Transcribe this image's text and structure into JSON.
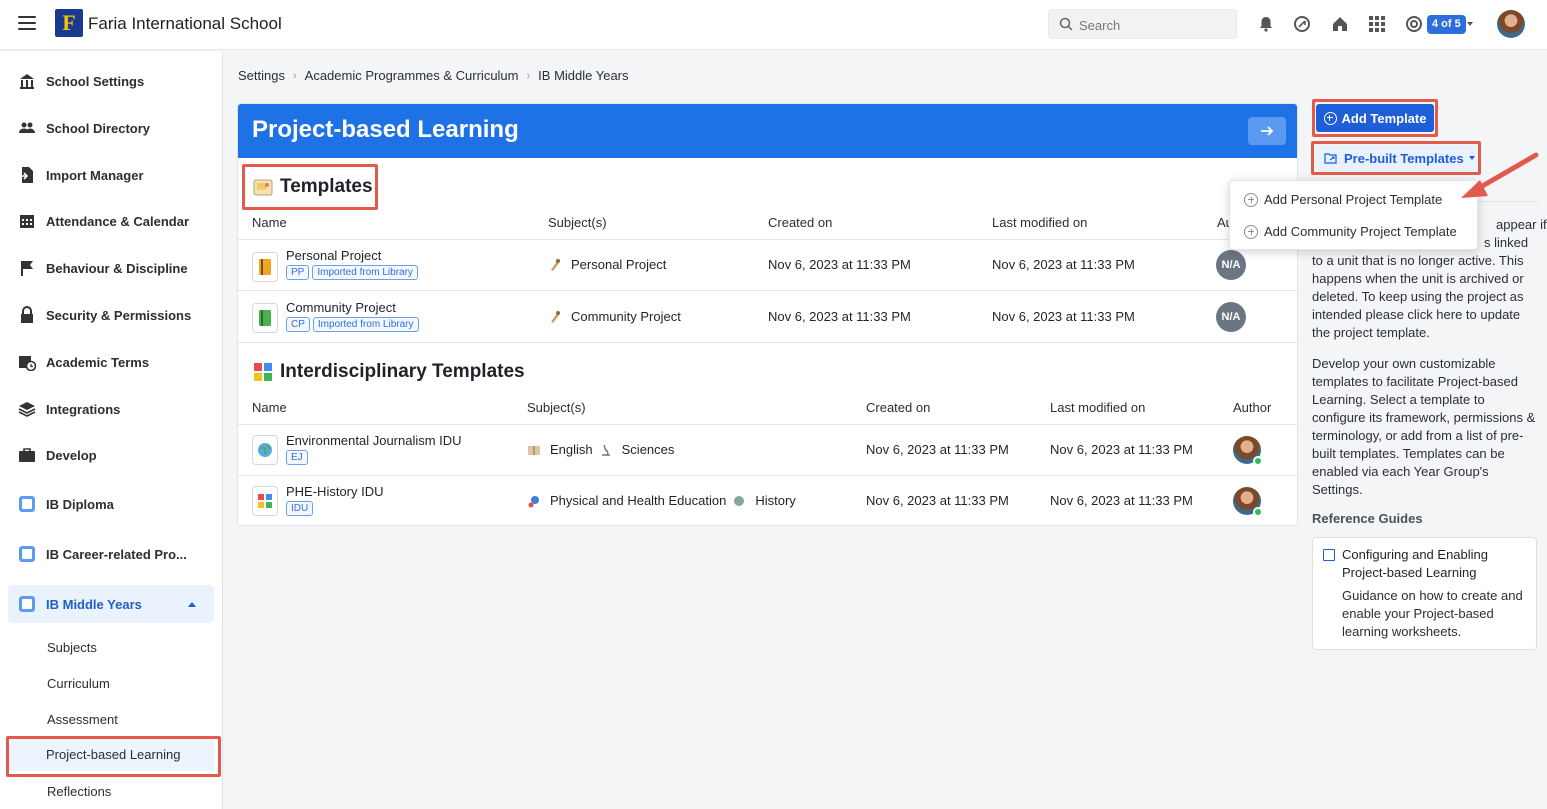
{
  "app": {
    "school_name": "Faria International School",
    "logo_letter": "F"
  },
  "topbar": {
    "search_placeholder": "Search",
    "switcher_badge": "4 of 5"
  },
  "sidebar": {
    "items": [
      {
        "label": "School Settings",
        "icon": "building-icon"
      },
      {
        "label": "School Directory",
        "icon": "people-icon"
      },
      {
        "label": "Import Manager",
        "icon": "import-icon"
      },
      {
        "label": "Attendance & Calendar",
        "icon": "calendar-icon"
      },
      {
        "label": "Behaviour & Discipline",
        "icon": "flag-icon"
      },
      {
        "label": "Security & Permissions",
        "icon": "lock-icon"
      },
      {
        "label": "Academic Terms",
        "icon": "calendar-clock-icon"
      },
      {
        "label": "Integrations",
        "icon": "layers-icon"
      },
      {
        "label": "Develop",
        "icon": "briefcase-icon"
      },
      {
        "label": "IB Diploma",
        "icon": "ib-icon"
      },
      {
        "label": "IB Career-related Pro...",
        "icon": "ib-icon"
      },
      {
        "label": "IB Middle Years",
        "icon": "ib-icon"
      }
    ],
    "sub_items": [
      "Subjects",
      "Curriculum",
      "Assessment",
      "Project-based Learning",
      "Reflections"
    ]
  },
  "breadcrumb": [
    "Settings",
    "Academic Programmes & Curriculum",
    "IB Middle Years"
  ],
  "banner": {
    "title": "Project-based Learning"
  },
  "templates": {
    "title": "Templates",
    "headers": {
      "name": "Name",
      "subjects": "Subject(s)",
      "created": "Created on",
      "modified": "Last modified on",
      "author": "Au"
    },
    "rows": [
      {
        "name": "Personal Project",
        "tags": [
          "PP",
          "Imported from Library"
        ],
        "subject": "Personal Project",
        "created": "Nov 6, 2023 at 11:33 PM",
        "modified": "Nov 6, 2023 at 11:33 PM",
        "author": "N/A",
        "color": "#f2a71b"
      },
      {
        "name": "Community Project",
        "tags": [
          "CP",
          "Imported from Library"
        ],
        "subject": "Community Project",
        "created": "Nov 6, 2023 at 11:33 PM",
        "modified": "Nov 6, 2023 at 11:33 PM",
        "author": "N/A",
        "color": "#4caf50"
      }
    ]
  },
  "interdisciplinary": {
    "title": "Interdisciplinary Templates",
    "headers": {
      "name": "Name",
      "subjects": "Subject(s)",
      "created": "Created on",
      "modified": "Last modified on",
      "author": "Author"
    },
    "rows": [
      {
        "name": "Environmental Journalism IDU",
        "tags": [
          "EJ"
        ],
        "subjects": [
          "English",
          "Sciences"
        ],
        "created": "Nov 6, 2023 at 11:33 PM",
        "modified": "Nov 6, 2023 at 11:33 PM"
      },
      {
        "name": "PHE-History IDU",
        "tags": [
          "IDU"
        ],
        "subjects": [
          "Physical and Health Education",
          "History"
        ],
        "created": "Nov 6, 2023 at 11:33 PM",
        "modified": "Nov 6, 2023 at 11:33 PM"
      }
    ]
  },
  "actions": {
    "add_template": "Add Template",
    "prebuilt": "Pre-built Templates",
    "dropdown": [
      "Add Personal Project Template",
      "Add Community Project Template"
    ]
  },
  "info": {
    "partial_lines": [
      "appear if",
      "s linked"
    ],
    "paragraph1": "to a unit that is no longer active. This happens when the unit is archived or deleted. To keep using the project as intended please click here to update the project template.",
    "paragraph2": "Develop your own customizable templates to facilitate Project-based Learning. Select a template to configure its framework, permissions & terminology, or add from a list of pre-built templates. Templates can be enabled via each Year Group's Settings."
  },
  "reference": {
    "title": "Reference Guides",
    "card_title": "Configuring and Enabling Project-based Learning",
    "card_desc": "Guidance on how to create and enable your Project-based learning worksheets."
  },
  "colors": {
    "accent": "#1e72e6",
    "highlight": "#e25a4c",
    "online": "#2fbf4f"
  }
}
